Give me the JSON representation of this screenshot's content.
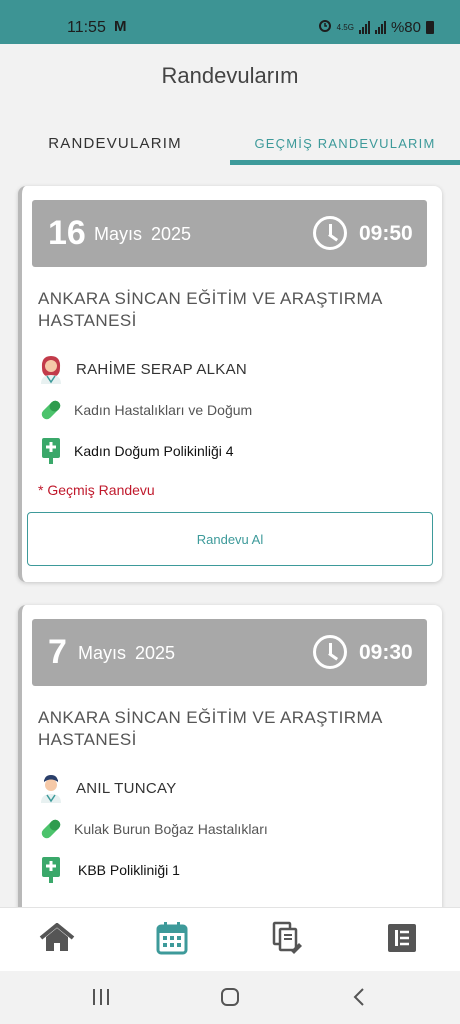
{
  "status_bar": {
    "time": "11:55",
    "mail_icon": "M",
    "network": "4.5G",
    "battery_text": "%80"
  },
  "header": {
    "title": "Randevularım"
  },
  "tabs": [
    {
      "label": "RANDEVULARIM",
      "active": false
    },
    {
      "label": "GEÇMİŞ RANDEVULARIM",
      "active": true
    }
  ],
  "appointments": [
    {
      "day": "16",
      "month": "Mayıs",
      "year": "2025",
      "time": "09:50",
      "hospital": "ANKARA SİNCAN EĞİTİM VE ARAŞTIRMA HASTANESİ",
      "doctor": "RAHİME SERAP ALKAN",
      "doctor_icon": "female-doctor-icon",
      "department": "Kadın Hastalıkları ve Doğum",
      "clinic": "Kadın Doğum Polikinliği 4",
      "note": "* Geçmiş Randevu",
      "button_label": "Randevu Al"
    },
    {
      "day": "7",
      "month": "Mayıs",
      "year": "2025",
      "time": "09:30",
      "hospital": "ANKARA SİNCAN EĞİTİM VE ARAŞTIRMA HASTANESİ",
      "doctor": "ANIL TUNCAY",
      "doctor_icon": "male-doctor-icon",
      "department": "Kulak Burun Boğaz Hastalıkları",
      "clinic": "KBB Polikliniği 1"
    }
  ],
  "bottom_nav": [
    {
      "icon": "home-icon",
      "active": false
    },
    {
      "icon": "calendar-icon",
      "active": true
    },
    {
      "icon": "documents-icon",
      "active": false
    },
    {
      "icon": "list-icon",
      "active": false
    }
  ],
  "colors": {
    "accent": "#3d9a9a",
    "status_bar": "#3d9494",
    "date_box": "#a8a8a8",
    "past_note": "#c0192c"
  }
}
